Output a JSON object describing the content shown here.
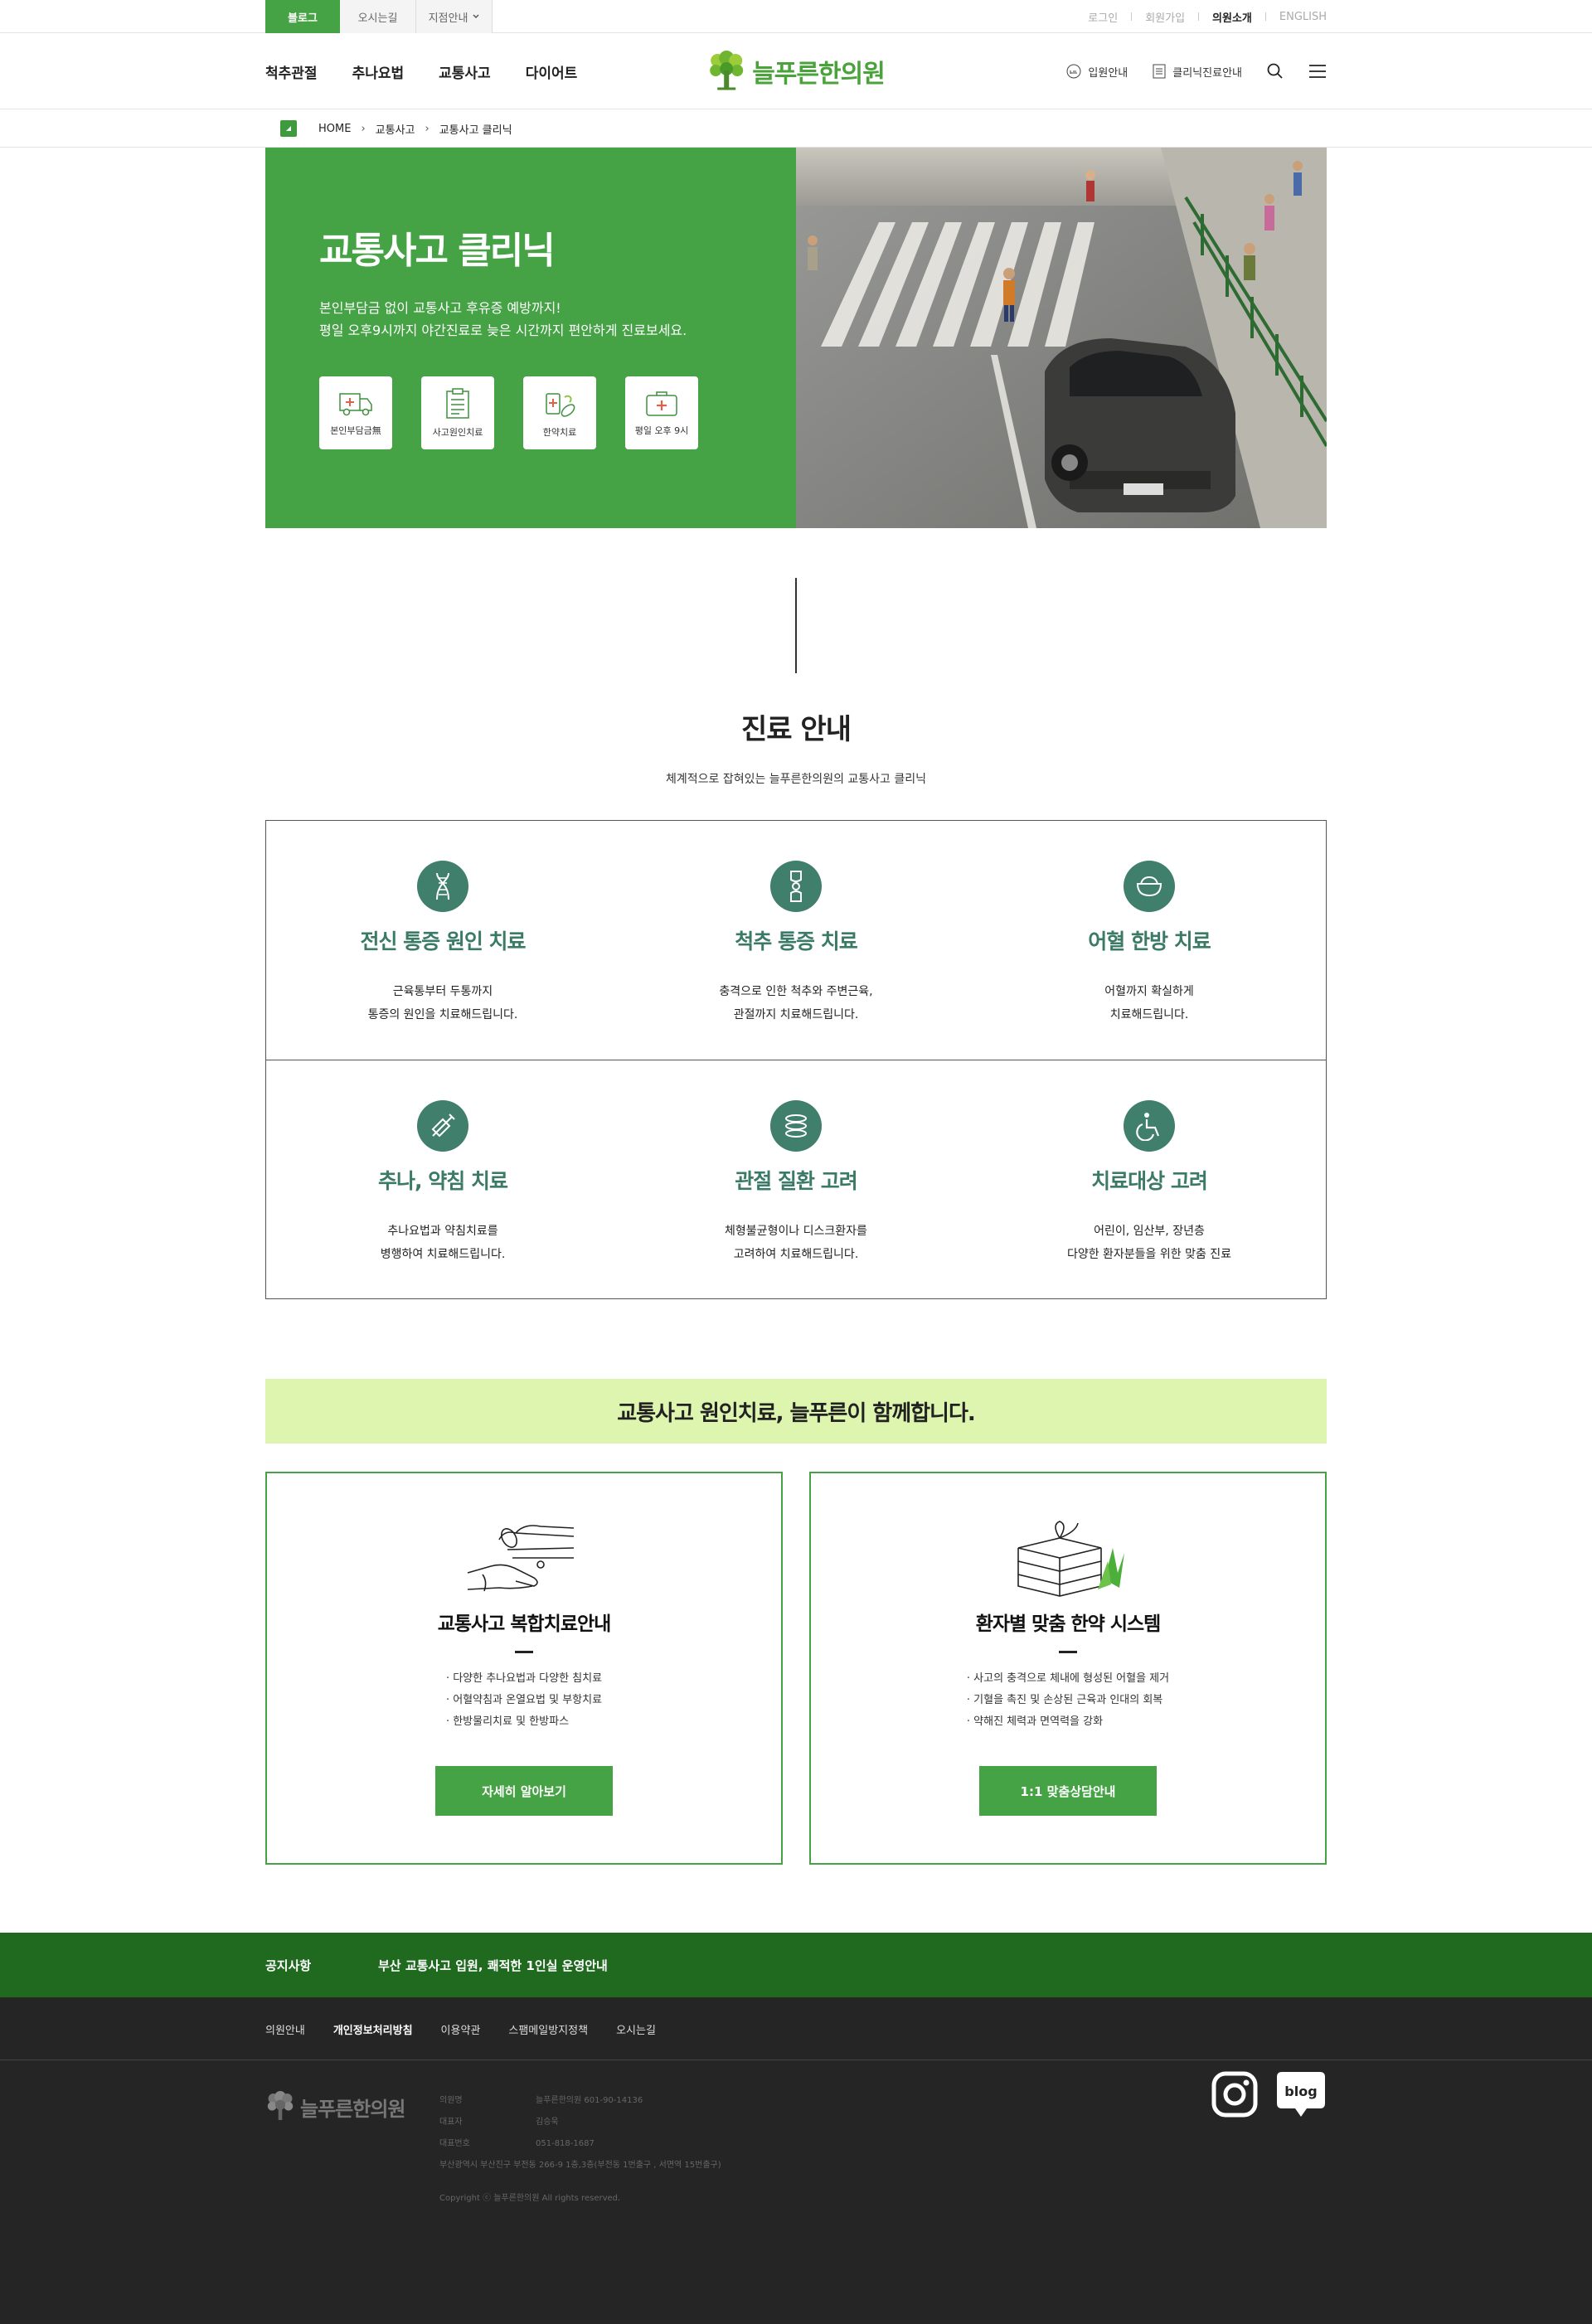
{
  "utilbar": {
    "tabs": [
      "블로그",
      "오시는길",
      "지점안내"
    ],
    "links": [
      "로그인",
      "회원가입",
      "의원소개",
      "ENGLISH"
    ]
  },
  "header": {
    "nav": [
      "척추관절",
      "추나요법",
      "교통사고",
      "다이어트"
    ],
    "logo": "늘푸른한의원",
    "right": [
      "입원안내",
      "클리닉진료안내"
    ]
  },
  "breadcrumb": [
    "HOME",
    "교통사고",
    "교통사고 클리닉"
  ],
  "hero": {
    "title": "교통사고 클리닉",
    "desc1": "본인부담금 없이 교통사고 후유증 예방까지!",
    "desc2": "평일 오후9시까지 야간진료로 늦은 시간까지 편안하게 진료보세요.",
    "icons": [
      {
        "label": "본인부담금無",
        "icon": "ambulance-icon"
      },
      {
        "label": "사고원인치료",
        "icon": "clipboard-icon"
      },
      {
        "label": "한약치료",
        "icon": "herbal-medicine-icon"
      },
      {
        "label": "평일 오후 9시",
        "icon": "first-aid-kit-icon"
      }
    ]
  },
  "treatment": {
    "title": "진료 안내",
    "subtitle": "체계적으로 잡혀있는 늘푸른한의원의 교통사고 클리닉",
    "items": [
      {
        "title": "전신 통증 원인 치료",
        "line1": "근육통부터 두통까지",
        "line2": "통증의 원인을 치료해드립니다.",
        "icon": "dna-icon"
      },
      {
        "title": "척추 통증 치료",
        "line1": "충격으로 인한 척추와 주변근육,",
        "line2": "관절까지 치료해드립니다.",
        "icon": "joint-icon"
      },
      {
        "title": "어혈 한방 치료",
        "line1": "어혈까지 확실하게",
        "line2": "치료해드립니다.",
        "icon": "herbal-bowl-icon"
      },
      {
        "title": "추나, 약침 치료",
        "line1": "추나요법과 약침치료를",
        "line2": "병행하여 치료해드립니다.",
        "icon": "syringe-icon"
      },
      {
        "title": "관절 질환 고려",
        "line1": "체형불균형이나 디스크환자를",
        "line2": "고려하여 치료해드립니다.",
        "icon": "spine-disc-icon"
      },
      {
        "title": "치료대상 고려",
        "line1": "어린이, 임산부, 장년층",
        "line2": "다양한 환자분들을 위한 맞춤 진료",
        "icon": "wheelchair-icon"
      }
    ]
  },
  "banner": "교통사고 원인치료, 늘푸른이 함께합니다.",
  "cards": [
    {
      "title": "교통사고 복합치료안내",
      "items": [
        "· 다양한 추나요법과 다양한 침치료",
        "· 어혈약침과 온열요법 및 부항치료",
        "· 한방물리치료 및 한방파스"
      ],
      "button": "자세히 알아보기",
      "icon": "hands-treatment-icon"
    },
    {
      "title": "환자별 맞춤 한약 시스템",
      "items": [
        "· 사고의 충격으로 체내에 형성된 어혈을 제거",
        "· 기혈을 촉진 및 손상된 근육과 인대의 회복",
        "· 약해진 체력과 면역력을 강화"
      ],
      "button": "1:1 맞춤상담안내",
      "icon": "herbal-package-icon"
    }
  ],
  "notice": {
    "label": "공지사항",
    "text": "부산 교통사고 입원, 쾌적한 1인실 운영안내"
  },
  "footer": {
    "nav": [
      "의원안내",
      "개인정보처리방침",
      "이용약관",
      "스팸메일방지정책",
      "오시는길"
    ],
    "logo": "늘푸른한의원",
    "info": [
      {
        "k": "의원명",
        "v": "늘푸른한의원 601-90-14136"
      },
      {
        "k": "대표자",
        "v": "김승욱"
      },
      {
        "k": "대표번호",
        "v": "051-818-1687"
      }
    ],
    "address": "부산광역시 부산진구 부전동 266-9 1층,3층(부전동 1번출구 , 서면역 15번출구)",
    "copyright": "Copyright ⓒ 늘푸른한의원 All rights reserved.",
    "sns": [
      "instagram-icon",
      "blog-icon"
    ],
    "blog_label": "blog"
  },
  "colors": {
    "brand_green": "#45a245",
    "teal": "#3f7f6b",
    "banner_bg": "#def5af",
    "notice_bg": "#1f6a1f",
    "footer_bg": "#252525"
  }
}
